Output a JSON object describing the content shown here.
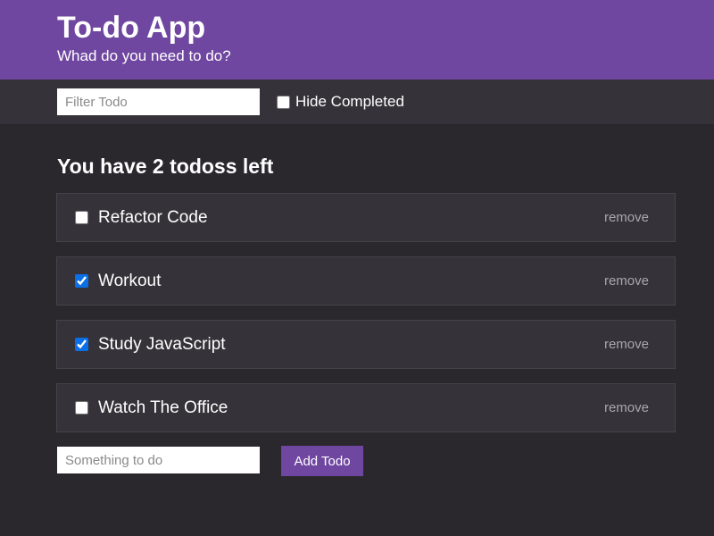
{
  "header": {
    "title": "To-do App",
    "subtitle": "Whad do you need to do?"
  },
  "filter": {
    "placeholder": "Filter Todo",
    "value": "",
    "hide_completed_label": "Hide Completed",
    "hide_completed_checked": false
  },
  "summary": {
    "text": "You have 2 todoss left"
  },
  "todos": [
    {
      "label": "Refactor Code",
      "completed": false,
      "remove_label": "remove"
    },
    {
      "label": "Workout",
      "completed": true,
      "remove_label": "remove"
    },
    {
      "label": "Study JavaScript",
      "completed": true,
      "remove_label": "remove"
    },
    {
      "label": "Watch The Office",
      "completed": false,
      "remove_label": "remove"
    }
  ],
  "new_todo": {
    "placeholder": "Something to do",
    "value": "",
    "add_label": "Add Todo"
  },
  "colors": {
    "accent": "#6f46a0",
    "background": "#2a282d",
    "panel": "#353239",
    "checkbox_checked": "#0b6fe8"
  }
}
